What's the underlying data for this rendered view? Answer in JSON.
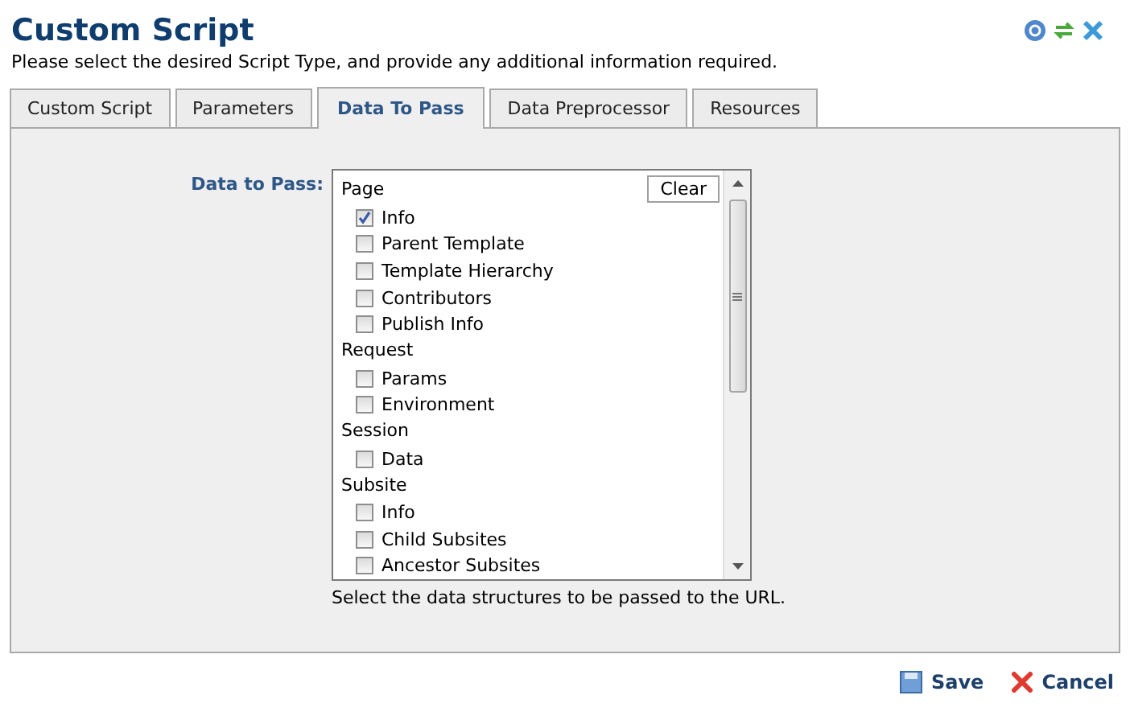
{
  "header": {
    "title": "Custom Script",
    "subtitle": "Please select the desired Script Type, and provide any additional information required."
  },
  "tabs": [
    {
      "label": "Custom Script",
      "selected": false
    },
    {
      "label": "Parameters",
      "selected": false
    },
    {
      "label": "Data To Pass",
      "selected": true
    },
    {
      "label": "Data Preprocessor",
      "selected": false
    },
    {
      "label": "Resources",
      "selected": false
    }
  ],
  "field": {
    "label": "Data to Pass:",
    "clear_button": "Clear",
    "hint": "Select the data structures to be passed to the URL.",
    "groups": [
      {
        "label": "Page",
        "items": [
          {
            "label": "Info",
            "checked": true
          },
          {
            "label": "Parent Template",
            "checked": false
          },
          {
            "label": "Template Hierarchy",
            "checked": false
          },
          {
            "label": "Contributors",
            "checked": false
          },
          {
            "label": "Publish Info",
            "checked": false
          }
        ]
      },
      {
        "label": "Request",
        "items": [
          {
            "label": "Params",
            "checked": false
          },
          {
            "label": "Environment",
            "checked": false
          }
        ]
      },
      {
        "label": "Session",
        "items": [
          {
            "label": "Data",
            "checked": false
          }
        ]
      },
      {
        "label": "Subsite",
        "items": [
          {
            "label": "Info",
            "checked": false
          },
          {
            "label": "Child Subsites",
            "checked": false
          },
          {
            "label": "Ancestor Subsites",
            "checked": false
          }
        ]
      }
    ]
  },
  "buttons": [
    {
      "kind": "save",
      "label": "Save"
    },
    {
      "kind": "cancel",
      "label": "Cancel"
    }
  ]
}
